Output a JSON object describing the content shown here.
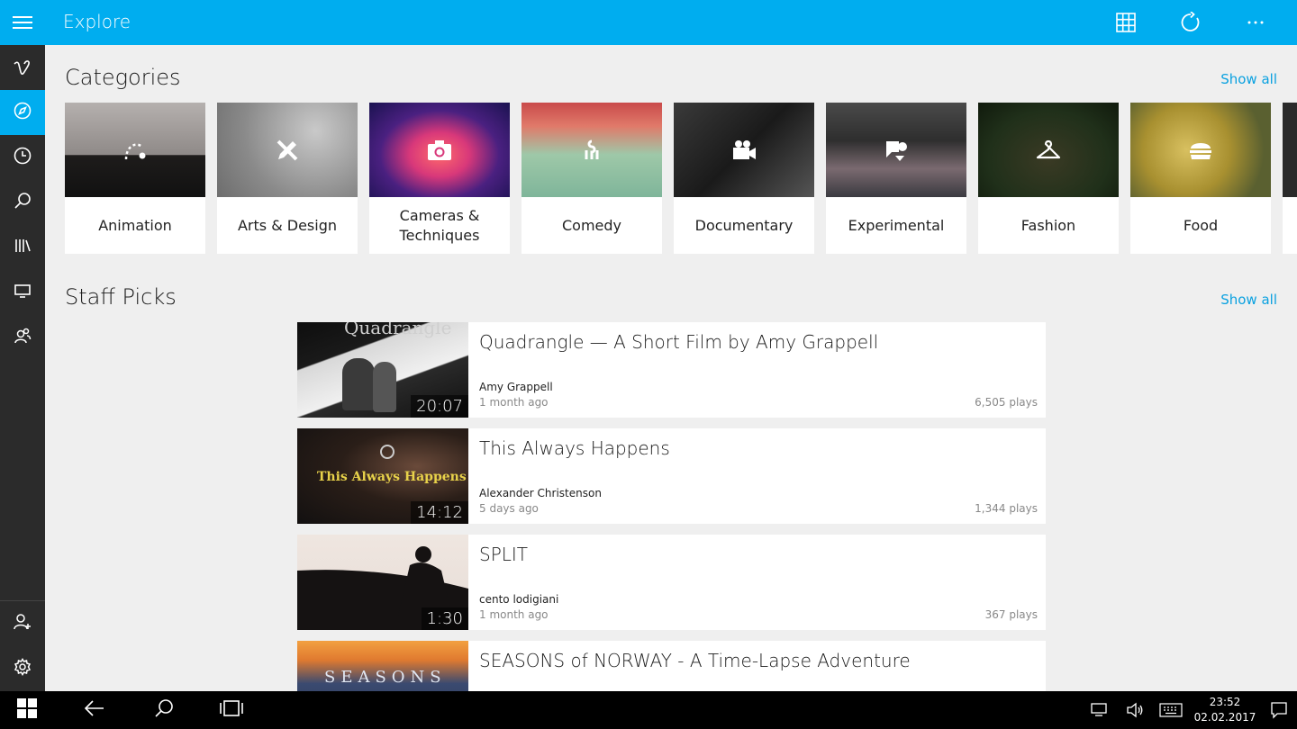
{
  "app": {
    "title": "Explore"
  },
  "categories": {
    "title": "Categories",
    "show_all": "Show all",
    "items": [
      {
        "label": "Animation",
        "icon": "animation-icon"
      },
      {
        "label": "Arts & Design",
        "icon": "pencil-ruler-icon"
      },
      {
        "label": "Cameras & Techniques",
        "icon": "camera-icon"
      },
      {
        "label": "Comedy",
        "icon": "comedy-icon"
      },
      {
        "label": "Documentary",
        "icon": "video-camera-icon"
      },
      {
        "label": "Experimental",
        "icon": "experimental-icon"
      },
      {
        "label": "Fashion",
        "icon": "hanger-icon"
      },
      {
        "label": "Food",
        "icon": "burger-icon"
      }
    ]
  },
  "staff_picks": {
    "title": "Staff Picks",
    "show_all": "Show all",
    "videos": [
      {
        "title": "Quadrangle — A Short Film by Amy Grappell",
        "author": "Amy Grappell",
        "age": "1 month ago",
        "plays": "6,505 plays",
        "duration": "20:07",
        "thumb_text": "Quadrangle"
      },
      {
        "title": "This Always Happens",
        "author": "Alexander Christenson",
        "age": "5 days ago",
        "plays": "1,344 plays",
        "duration": "14:12",
        "thumb_text": "This Always Happens"
      },
      {
        "title": "SPLIT",
        "author": "cento lodigiani",
        "age": "1 month ago",
        "plays": "367 plays",
        "duration": "1:30"
      },
      {
        "title": "SEASONS of NORWAY - A Time-Lapse Adventure",
        "thumb_text": "SEASONS"
      }
    ]
  },
  "taskbar": {
    "time": "23:52",
    "date": "02.02.2017"
  },
  "colors": {
    "accent": "#00adef",
    "sidebar": "#2b2b2b",
    "link": "#0aa1e0"
  }
}
